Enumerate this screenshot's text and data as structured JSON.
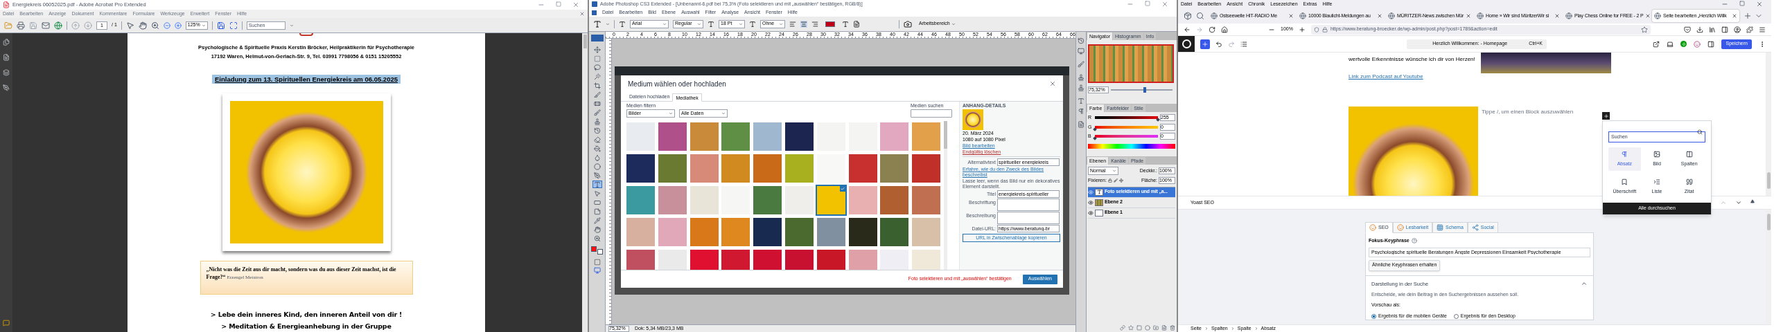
{
  "acrobat": {
    "title": "Energiekreis 06052025.pdf - Adobe Acrobat Pro Extended",
    "menu": [
      "Datei",
      "Bearbeiten",
      "Anzeige",
      "Dokument",
      "Kommentare",
      "Formulare",
      "Werkzeuge",
      "Erweitert",
      "Fenster",
      "Hilfe"
    ],
    "page_number": "1",
    "page_count": "/ 1",
    "zoom": "125%",
    "search_placeholder": "Suchen",
    "header_lines": [
      "Psychologische & Spirituelle Praxis Kerstin Bröcker, Heilpraktikerin für Psychotherapie",
      "17192 Waren, Helmut-von-Gerlach-Str. 9, Tel. 03991 7798056 &  0151 15205552"
    ],
    "heading": "Einladung zum 13. Spirituellen Energiekreis am 06.05.2025",
    "quote": "„Nicht was die Zeit aus dir macht, sondern was du aus dieser Zeit machst, ist die Frage?“",
    "quote_author": "Erzengel Metatron",
    "bullets": [
      "> Lebe dein inneres Kind, den inneren Anteil von dir !",
      "> Meditation & Energieanhebung in der Gruppe"
    ]
  },
  "photoshop": {
    "title": "Adobe Photoshop CS3 Extended - [Unbenannt-6.pdf bei 75,3% (Foto selektieren und mit „auswählen“ bestätigen, RGB/8)]",
    "menu": [
      "Datei",
      "Bearbeiten",
      "Bild",
      "Ebene",
      "Auswahl",
      "Filter",
      "Analyse",
      "Ansicht",
      "Fenster",
      "Hilfe"
    ],
    "options": {
      "font": "Arial",
      "style": "Regular",
      "size": "18 Pt",
      "antialias": "Ohne",
      "workspace": "Arbeitsbereich"
    },
    "ruler_labels": [
      "0",
      "2",
      "4",
      "6",
      "8",
      "10",
      "12",
      "14",
      "16",
      "18",
      "20",
      "22",
      "24",
      "26",
      "28",
      "30",
      "32",
      "34",
      "36",
      "38",
      "40",
      "42",
      "44",
      "46",
      "48",
      "50",
      "52",
      "54",
      "56",
      "58",
      "60",
      "62",
      "64",
      "66"
    ],
    "tools": [
      {
        "kind": "move",
        "selected": false
      },
      {
        "kind": "marquee",
        "selected": false
      },
      {
        "kind": "lasso",
        "selected": false
      },
      {
        "kind": "wand",
        "selected": false
      },
      {
        "kind": "crop",
        "selected": false
      },
      {
        "kind": "slice",
        "selected": false
      },
      {
        "kind": "healing",
        "selected": false
      },
      {
        "kind": "brush",
        "selected": false
      },
      {
        "kind": "stamp",
        "selected": false
      },
      {
        "kind": "history",
        "selected": false
      },
      {
        "kind": "eraser",
        "selected": false
      },
      {
        "kind": "bucket",
        "selected": false
      },
      {
        "kind": "blur",
        "selected": false
      },
      {
        "kind": "dodge",
        "selected": false
      },
      {
        "kind": "pen",
        "selected": false
      },
      {
        "kind": "type",
        "selected": true
      },
      {
        "kind": "path",
        "selected": false
      },
      {
        "kind": "shape",
        "selected": false
      },
      {
        "kind": "notes",
        "selected": false
      },
      {
        "kind": "eyedropper",
        "selected": false
      },
      {
        "kind": "hand",
        "selected": false
      },
      {
        "kind": "zoom",
        "selected": false
      }
    ],
    "media_modal": {
      "title": "Medium wählen oder hochladen",
      "tabs": [
        {
          "label": "Dateien hochladen",
          "selected": false
        },
        {
          "label": "Mediathek",
          "selected": true
        }
      ],
      "filter_label": "Medien filtern",
      "filters": [
        "Bilder",
        "Alle Daten"
      ],
      "search_label": "Medien suchen",
      "items": [
        {
          "selected": false
        },
        {
          "selected": false
        },
        {
          "selected": false
        },
        {
          "selected": false
        },
        {
          "selected": false
        },
        {
          "selected": false
        },
        {
          "selected": false
        },
        {
          "selected": false
        },
        {
          "selected": false
        },
        {
          "selected": false
        },
        {
          "selected": false
        },
        {
          "selected": false
        },
        {
          "selected": false
        },
        {
          "selected": false
        },
        {
          "selected": false
        },
        {
          "selected": false
        },
        {
          "selected": false
        },
        {
          "selected": false
        },
        {
          "selected": false
        },
        {
          "selected": false
        },
        {
          "selected": false
        },
        {
          "selected": false
        },
        {
          "selected": false
        },
        {
          "selected": false
        },
        {
          "selected": false
        },
        {
          "selected": false
        },
        {
          "selected": true
        },
        {
          "selected": false
        },
        {
          "selected": false
        },
        {
          "selected": false
        },
        {
          "selected": false
        },
        {
          "selected": false
        },
        {
          "selected": false
        },
        {
          "selected": false
        },
        {
          "selected": false
        },
        {
          "selected": false
        },
        {
          "selected": false
        },
        {
          "selected": false
        },
        {
          "selected": false
        },
        {
          "selected": false
        },
        {
          "selected": false
        },
        {
          "selected": false
        },
        {
          "selected": false
        },
        {
          "selected": false
        },
        {
          "selected": false
        },
        {
          "selected": false
        },
        {
          "selected": false
        },
        {
          "selected": false
        },
        {
          "selected": false
        },
        {
          "selected": false
        }
      ],
      "details": {
        "heading": "ANHANG-DETAILS",
        "meta": [
          "20. März 2024",
          "1080 auf 1080 Pixel"
        ],
        "edit_link": "Bild bearbeiten",
        "delete_link": "Endgültig löschen",
        "fields": [
          {
            "label": "Alternativtext",
            "value": "spiritueller energiekreis"
          },
          {
            "label": "Titel",
            "value": "energiekreis-spiritueller"
          },
          {
            "label": "Beschriftung"
          },
          {
            "label": "Beschreibung"
          },
          {
            "label": "Datei-URL:",
            "value": "https://www.beratung-br"
          }
        ],
        "help_link": "Erfahre, wie du den Zweck des Bildes beschreibst",
        "help_text": "Lasse leer, wenn das Bild nur ein dekoratives Element darstellt.",
        "copy_button": "URL in Zwischenablage kopieren"
      },
      "hint": "Foto selektieren und mit „auswählen“ bestätigen",
      "select_button": "Auswählen"
    },
    "navigator": {
      "tabs": [
        {
          "label": "Navigator",
          "selected": true
        },
        {
          "label": "Histogramm",
          "selected": false
        },
        {
          "label": "Info",
          "selected": false
        }
      ],
      "zoom": "75,32%",
      "level": 0.55
    },
    "color": {
      "tabs": [
        {
          "label": "Farbe",
          "selected": true
        },
        {
          "label": "Farbfelder",
          "selected": false
        },
        {
          "label": "Stile",
          "selected": false
        }
      ],
      "channels": [
        {
          "name": "R",
          "value": "255",
          "level": 1
        },
        {
          "name": "G",
          "value": "0",
          "level": 0
        },
        {
          "name": "B",
          "value": "0",
          "level": 0
        }
      ]
    },
    "layers": {
      "tabs": [
        {
          "label": "Ebenen",
          "selected": true
        },
        {
          "label": "Kanäle",
          "selected": false
        },
        {
          "label": "Pfade",
          "selected": false
        }
      ],
      "blend_mode": "Normal",
      "opacity_label": "Deckkr.:",
      "opacity": "100%",
      "lock_label": "Fixieren:",
      "fill_label": "Fläche:",
      "fill": "100%",
      "items": [
        {
          "name": "Foto selektieren und mit „a...",
          "kind": "text",
          "selected": true
        },
        {
          "name": "Ebene 2",
          "kind": "image",
          "selected": false
        },
        {
          "name": "Ebene 1",
          "kind": "blank",
          "selected": false
        }
      ]
    },
    "status": {
      "zoom": "75,32%",
      "doc": "Dok: 5,34 MB/23,3 MB"
    }
  },
  "browser": {
    "menu": [
      "Datei",
      "Bearbeiten",
      "Ansicht",
      "Chronik",
      "Lesezeichen",
      "Extras",
      "Hilfe"
    ],
    "tabs": [
      {
        "label": "Ostseewelle HIT-RADIO Me",
        "selected": false
      },
      {
        "label": "10000 Blaulicht-Meldungen au",
        "selected": false
      },
      {
        "label": "MÜRITZER-News zwischen Mür",
        "selected": false
      },
      {
        "label": "Home » Wir sind MüritzerWir si",
        "selected": false
      },
      {
        "label": "Play Chess Online for FREE - 2 P",
        "selected": false
      },
      {
        "label": "Seite bearbeiten „Herzlich Willk",
        "selected": true
      }
    ],
    "zoom": "100%",
    "url": "https://www.beratung-broecker.de/wp-admin/post.php?post=1789&action=edit",
    "editor": {
      "document_title": "Herzlich Willkommen: - Homepage",
      "shortcut": "Ctrl+K",
      "save": "Speichern",
      "paragraph": "wertvolle Erkenntnisse wünsche ich dir von Herzen!",
      "link": "Link zum Podcast auf Youtube",
      "empty_block": {
        "placeholder": "Tippe /, um einen Block auszuwählen"
      },
      "inserter": {
        "search_placeholder": "Suchen",
        "blocks": [
          {
            "label": "Absatz",
            "kind": "paragraph",
            "selected": true
          },
          {
            "label": "Bild",
            "kind": "image",
            "selected": false
          },
          {
            "label": "Spalten",
            "kind": "columns",
            "selected": false
          },
          {
            "label": "Überschrift",
            "kind": "heading",
            "selected": false
          },
          {
            "label": "Liste",
            "kind": "list",
            "selected": false
          },
          {
            "label": "Zitat",
            "kind": "quote",
            "selected": false
          }
        ],
        "browse_all": "Alle durchsuchen"
      }
    },
    "yoast": {
      "title": "Yoast SEO",
      "tabs": [
        {
          "label": "SEO",
          "selected": true
        },
        {
          "label": "Lesbarkeit",
          "selected": false
        },
        {
          "label": "Schema",
          "selected": false
        },
        {
          "label": "Social",
          "selected": false
        }
      ],
      "keyphrase_label": "Fokus-Keyphrase",
      "keyphrase": "Psychologische spirituelle Beratungen Ängste Depressionen Einsamkeit Psychotherapie",
      "related_button": "Ähnliche Keyphrasen erhalten",
      "section_title": "Darstellung in der Suche",
      "expanded": true,
      "section_description": "Entscheide, wie dein Beitrag in den Suchergebnissen aussehen soll.",
      "preview_label": "Vorschau als:",
      "preview_options": [
        {
          "label": "Ergebnis für die mobilen Geräte",
          "selected": true
        },
        {
          "label": "Ergebnis für den Desktop",
          "selected": false
        }
      ]
    },
    "breadcrumb": [
      "Seite",
      "Spalten",
      "Spalte",
      "Absatz"
    ]
  }
}
